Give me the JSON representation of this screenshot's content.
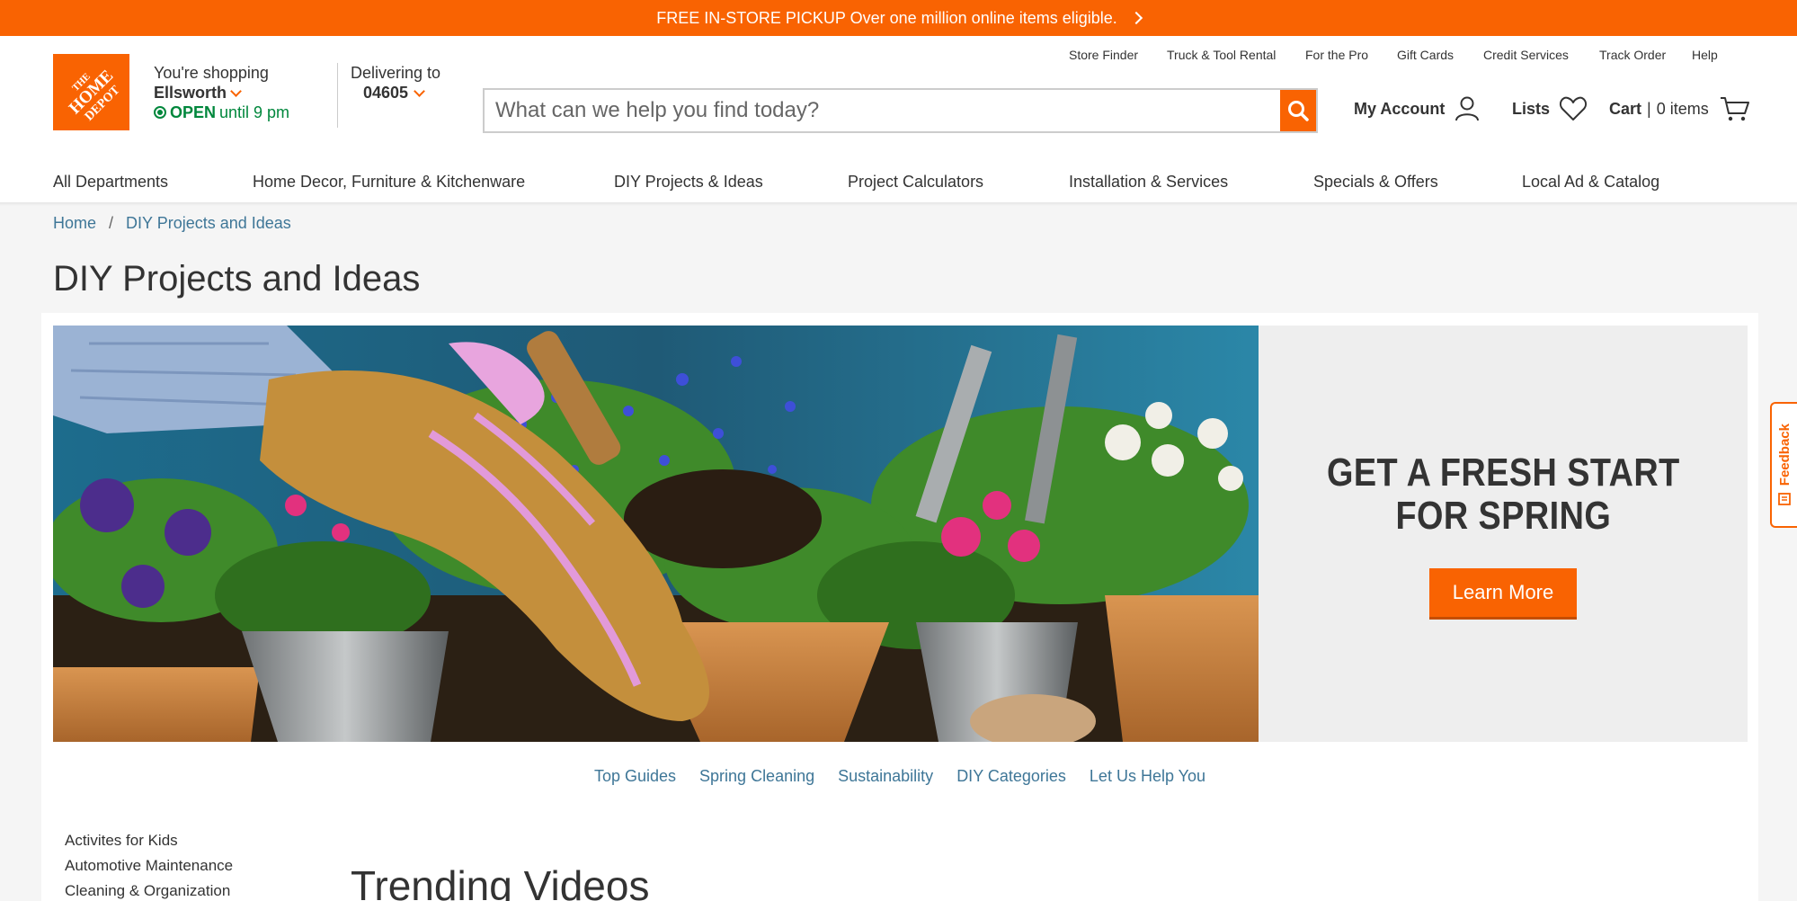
{
  "promo": {
    "bold": "FREE IN-STORE PICKUP",
    "text": "Over one million online items eligible."
  },
  "logo": {
    "alt": "THE HOME DEPOT"
  },
  "store": {
    "label": "You're shopping",
    "name": "Ellsworth",
    "status": "OPEN",
    "hours": "until 9 pm"
  },
  "delivery": {
    "label": "Delivering to",
    "zip": "04605"
  },
  "search": {
    "placeholder": "What can we help you find today?",
    "value": ""
  },
  "utility_links": [
    "Store Finder",
    "Truck & Tool Rental",
    "For the Pro",
    "Gift Cards",
    "Credit Services",
    "Track Order",
    "Help"
  ],
  "account": {
    "label": "My Account"
  },
  "lists": {
    "label": "Lists"
  },
  "cart": {
    "label": "Cart",
    "items": "0 items"
  },
  "nav": [
    "All Departments",
    "Home Decor, Furniture & Kitchenware",
    "DIY Projects & Ideas",
    "Project Calculators",
    "Installation & Services",
    "Specials & Offers",
    "Local Ad & Catalog"
  ],
  "breadcrumb": [
    "Home",
    "DIY Projects and Ideas"
  ],
  "page_title": "DIY Projects and Ideas",
  "hero": {
    "headline_line1": "GET A FRESH START",
    "headline_line2": "FOR SPRING",
    "cta": "Learn More"
  },
  "sublinks": [
    "Top Guides",
    "Spring Cleaning",
    "Sustainability",
    "DIY Categories",
    "Let Us Help You"
  ],
  "side_categories": [
    "Activites for Kids",
    "Automotive Maintenance",
    "Cleaning & Organization"
  ],
  "section_title": "Trending Videos",
  "feedback": {
    "label": "Feedback"
  },
  "colors": {
    "brand": "#f96302",
    "link": "#3e7697",
    "open": "#00873c"
  }
}
